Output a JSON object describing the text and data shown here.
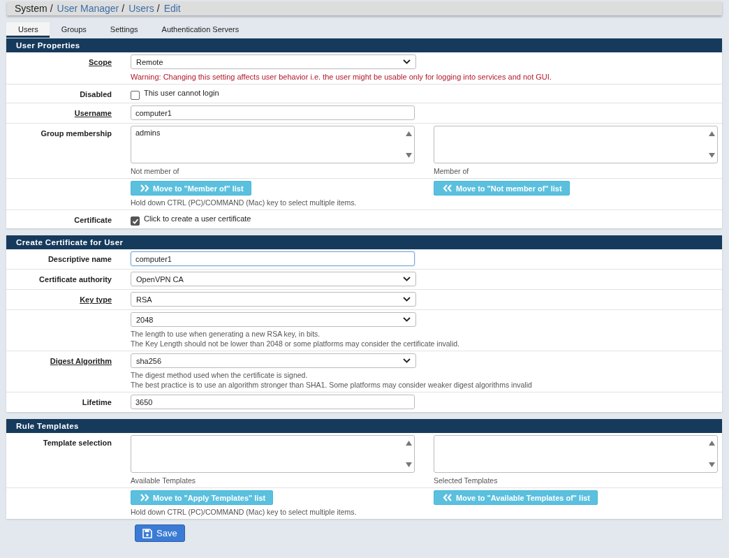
{
  "breadcrumb": [
    {
      "label": "System",
      "link": false,
      "separator": "/"
    },
    {
      "label": "User Manager",
      "link": true,
      "separator": "/"
    },
    {
      "label": "Users",
      "link": true,
      "separator": "/"
    },
    {
      "label": "Edit",
      "link": true
    }
  ],
  "tabs": [
    {
      "label": "Users",
      "selected": true
    },
    {
      "label": "Groups",
      "selected": false
    },
    {
      "label": "Settings",
      "selected": false
    },
    {
      "label": "Authentication Servers",
      "selected": false
    }
  ],
  "sections": [
    {
      "title": "User Properties",
      "rows": [
        {
          "kind": "select",
          "label": "Scope",
          "underlined": true,
          "value": "Remote",
          "warning": "Warning: Changing this setting affects user behavior i.e. the user might be usable only for logging into services and not GUI."
        },
        {
          "kind": "checkbox",
          "label": "Disabled",
          "underlined": false,
          "checked": false,
          "text": "This user cannot login"
        },
        {
          "kind": "input",
          "label": "Username",
          "underlined": true,
          "value": "computer1",
          "focused": false
        },
        {
          "kind": "dual_list",
          "label": "Group membership",
          "underlined": false,
          "left_items": [
            "admins"
          ],
          "left_caption": "Not member of",
          "right_items": [],
          "right_caption": "Member of"
        },
        {
          "kind": "move_buttons",
          "buttons": [
            {
              "label": "Move to \"Member of\" list",
              "kind": "add"
            },
            {
              "label": "Move to \"Not member of\" list",
              "kind": "remove"
            }
          ],
          "help": "Hold down CTRL (PC)/COMMAND (Mac) key to select multiple items."
        },
        {
          "kind": "checkbox",
          "label": "Certificate",
          "underlined": false,
          "checked": true,
          "text": "Click to create a user certificate"
        }
      ]
    },
    {
      "title": "Create Certificate for User",
      "rows": [
        {
          "kind": "input",
          "label": "Descriptive name",
          "underlined": false,
          "value": "computer1",
          "focused": true
        },
        {
          "kind": "select",
          "label": "Certificate authority",
          "underlined": false,
          "value": "OpenVPN CA"
        },
        {
          "kind": "select",
          "label": "Key type",
          "underlined": true,
          "value": "RSA"
        },
        {
          "kind": "select",
          "value": "2048",
          "help": [
            "The length to use when generating a new RSA key, in bits.",
            "The Key Length should not be lower than 2048 or some platforms may consider the certificate invalid."
          ]
        },
        {
          "kind": "select",
          "label": "Digest Algorithm",
          "underlined": true,
          "value": "sha256",
          "help": [
            "The digest method used when the certificate is signed.",
            "The best practice is to use an algorithm stronger than SHA1. Some platforms may consider weaker digest algorithms invalid"
          ]
        },
        {
          "kind": "input",
          "label": "Lifetime",
          "underlined": false,
          "value": "3650",
          "focused": false
        }
      ]
    },
    {
      "title": "Rule Templates",
      "rows": [
        {
          "kind": "dual_list",
          "label": "Template selection",
          "underlined": false,
          "left_items": [],
          "left_caption": "Available Templates",
          "right_items": [],
          "right_caption": "Selected Templates"
        },
        {
          "kind": "move_buttons",
          "buttons": [
            {
              "label": "Move to \"Apply Templates\" list",
              "kind": "add"
            },
            {
              "label": "Move to \"Available Templates of\" list",
              "kind": "remove"
            }
          ],
          "help": "Hold down CTRL (PC)/COMMAND (Mac) key to select multiple items."
        }
      ]
    }
  ],
  "save_button": "Save"
}
